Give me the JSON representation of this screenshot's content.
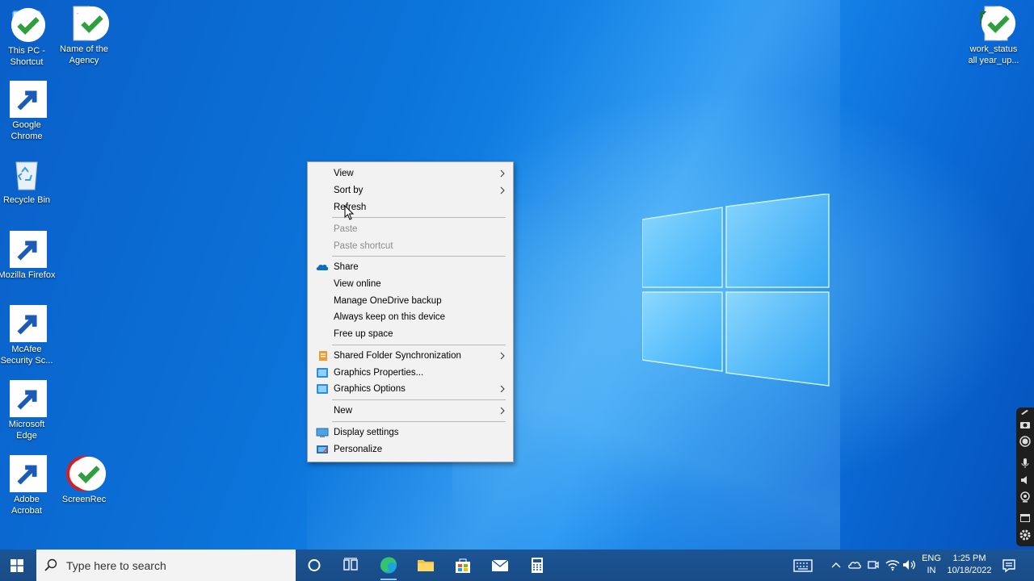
{
  "desktop": {
    "icons": [
      {
        "label": "This PC - Shortcut",
        "icon": "this-pc-icon"
      },
      {
        "label": "Name of the Agency",
        "icon": "word-document-icon"
      },
      {
        "label": "Google Chrome",
        "icon": "chrome-icon"
      },
      {
        "label": "Recycle Bin",
        "icon": "recycle-bin-icon"
      },
      {
        "label": "Mozilla Firefox",
        "icon": "firefox-icon"
      },
      {
        "label": "McAfee Security Sc...",
        "icon": "mcafee-icon"
      },
      {
        "label": "Microsoft Edge",
        "icon": "edge-icon"
      },
      {
        "label": "Adobe Acrobat",
        "icon": "acrobat-icon"
      },
      {
        "label": "ScreenRec",
        "icon": "screenrec-icon"
      },
      {
        "label": "work_status all year_up...",
        "icon": "excel-icon"
      }
    ]
  },
  "context_menu": {
    "items": [
      {
        "label": "View",
        "submenu": true
      },
      {
        "label": "Sort by",
        "submenu": true
      },
      {
        "label": "Refresh"
      },
      {
        "label": "Paste",
        "disabled": true
      },
      {
        "label": "Paste shortcut",
        "disabled": true
      },
      {
        "label": "Share",
        "icon": "onedrive-cloud-icon"
      },
      {
        "label": "View online"
      },
      {
        "label": "Manage OneDrive backup"
      },
      {
        "label": "Always keep on this device"
      },
      {
        "label": "Free up space"
      },
      {
        "label": "Shared Folder Synchronization",
        "icon": "shared-folder-sync-icon",
        "submenu": true
      },
      {
        "label": "Graphics Properties...",
        "icon": "intel-graphics-icon"
      },
      {
        "label": "Graphics Options",
        "icon": "intel-graphics-icon",
        "submenu": true
      },
      {
        "label": "New",
        "submenu": true
      },
      {
        "label": "Display settings",
        "icon": "display-icon"
      },
      {
        "label": "Personalize",
        "icon": "personalize-icon"
      }
    ]
  },
  "taskbar": {
    "search_placeholder": "Type here to search",
    "language_top": "ENG",
    "language_bottom": "IN",
    "time": "1:25 PM",
    "date": "10/18/2022"
  },
  "colors": {
    "taskbar": "#1c5494",
    "menu_bg": "#f2f2f2",
    "desktop_accent": "#0b74da"
  }
}
